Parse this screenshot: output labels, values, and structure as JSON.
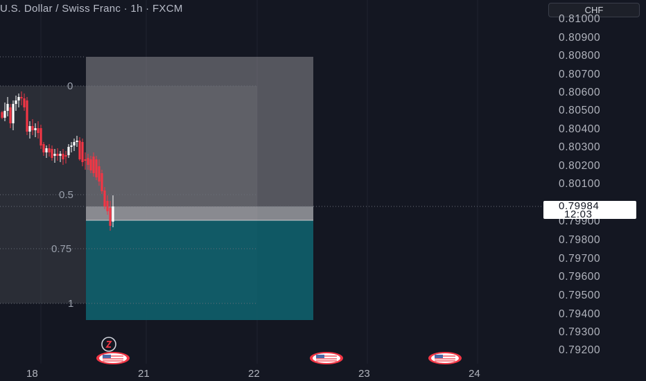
{
  "header": {
    "title": "U.S. Dollar / Swiss Franc · 1h · FXCM",
    "currency_button": "CHF"
  },
  "price_axis": {
    "labels": [
      "0.81000",
      "0.80900",
      "0.80800",
      "0.80700",
      "0.80600",
      "0.80500",
      "0.80400",
      "0.80300",
      "0.80200",
      "0.80100",
      "0.79900",
      "0.79800",
      "0.79700",
      "0.79600",
      "0.79500",
      "0.79400",
      "0.79300",
      "0.79200"
    ],
    "last_price": "0.79984",
    "countdown": "12:03"
  },
  "time_axis": {
    "labels": [
      "18",
      "21",
      "22",
      "23",
      "24"
    ]
  },
  "fib_levels": [
    "0",
    "0.5",
    "0.75",
    "1"
  ],
  "icons": [
    "lightning-icon",
    "us-flag-icon"
  ],
  "colors": {
    "background": "#141722",
    "bearish": "#f23645",
    "bullish": "#ffffff",
    "stop_zone": "#8a8b90",
    "target_zone": "#0e5f6b"
  }
}
